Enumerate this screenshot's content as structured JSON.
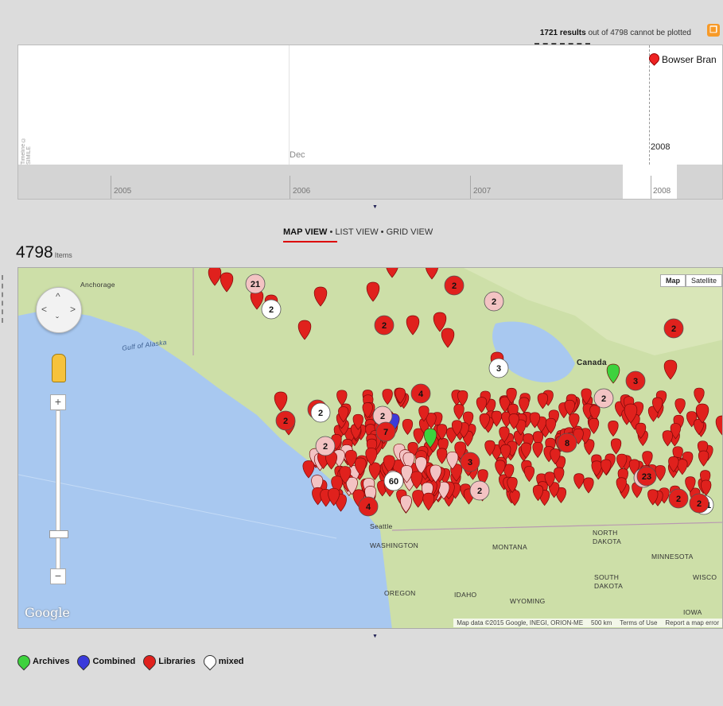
{
  "results": {
    "count_label": "1721 results",
    "suffix": "out of 4798 cannot be plotted",
    "rss_icon": "feed-icon"
  },
  "timeline": {
    "event_label": "Bowser Bran",
    "month_label": "Dec",
    "upper_year": "2008",
    "years": [
      "2005",
      "2006",
      "2007",
      "2008"
    ],
    "credit": "Timeline © SIMILE"
  },
  "views": {
    "map": "MAP VIEW",
    "list": "LIST VIEW",
    "grid": "GRID VIEW",
    "sep": "•"
  },
  "count": {
    "value": "4798",
    "unit": "Items"
  },
  "map": {
    "type_map": "Map",
    "type_satellite": "Satellite",
    "labels": {
      "anchorage": "Anchorage",
      "gulf": "Gulf of Alaska",
      "canada": "Canada",
      "seattle": "Seattle",
      "washington": "WASHINGTON",
      "montana": "MONTANA",
      "north_dakota_1": "NORTH",
      "north_dakota_2": "DAKOTA",
      "minnesota": "MINNESOTA",
      "south_dakota_1": "SOUTH",
      "south_dakota_2": "DAKOTA",
      "oregon": "OREGON",
      "idaho": "IDAHO",
      "wyoming": "WYOMING",
      "iowa": "IOWA",
      "wisconsin": "WISCO"
    },
    "cluster_labels": [
      "21",
      "2",
      "2",
      "2",
      "2",
      "2",
      "3",
      "3",
      "3",
      "2",
      "4",
      "2",
      "2",
      "7",
      "3",
      "2",
      "60",
      "8",
      "3",
      "4",
      "23",
      "101",
      "2",
      "2",
      "2",
      "2"
    ],
    "google_logo": "Google",
    "attribution": "Map data ©2015 Google, INEGI, ORION-ME",
    "scale": "500 km",
    "terms": "Terms of Use",
    "report": "Report a map error",
    "colors": {
      "water": "#a8c8f0",
      "land": "#cddfa8",
      "marker_red": "#e0211d",
      "marker_pink": "#f3c3c3",
      "marker_green": "#3dd23d",
      "marker_blue": "#3b3bdb"
    }
  },
  "legend": [
    {
      "label": "Archives",
      "color": "#3dd23d"
    },
    {
      "label": "Combined",
      "color": "#3b3bdb"
    },
    {
      "label": "Libraries",
      "color": "#e0211d"
    },
    {
      "label": "mixed",
      "color": "#ffffff"
    }
  ]
}
